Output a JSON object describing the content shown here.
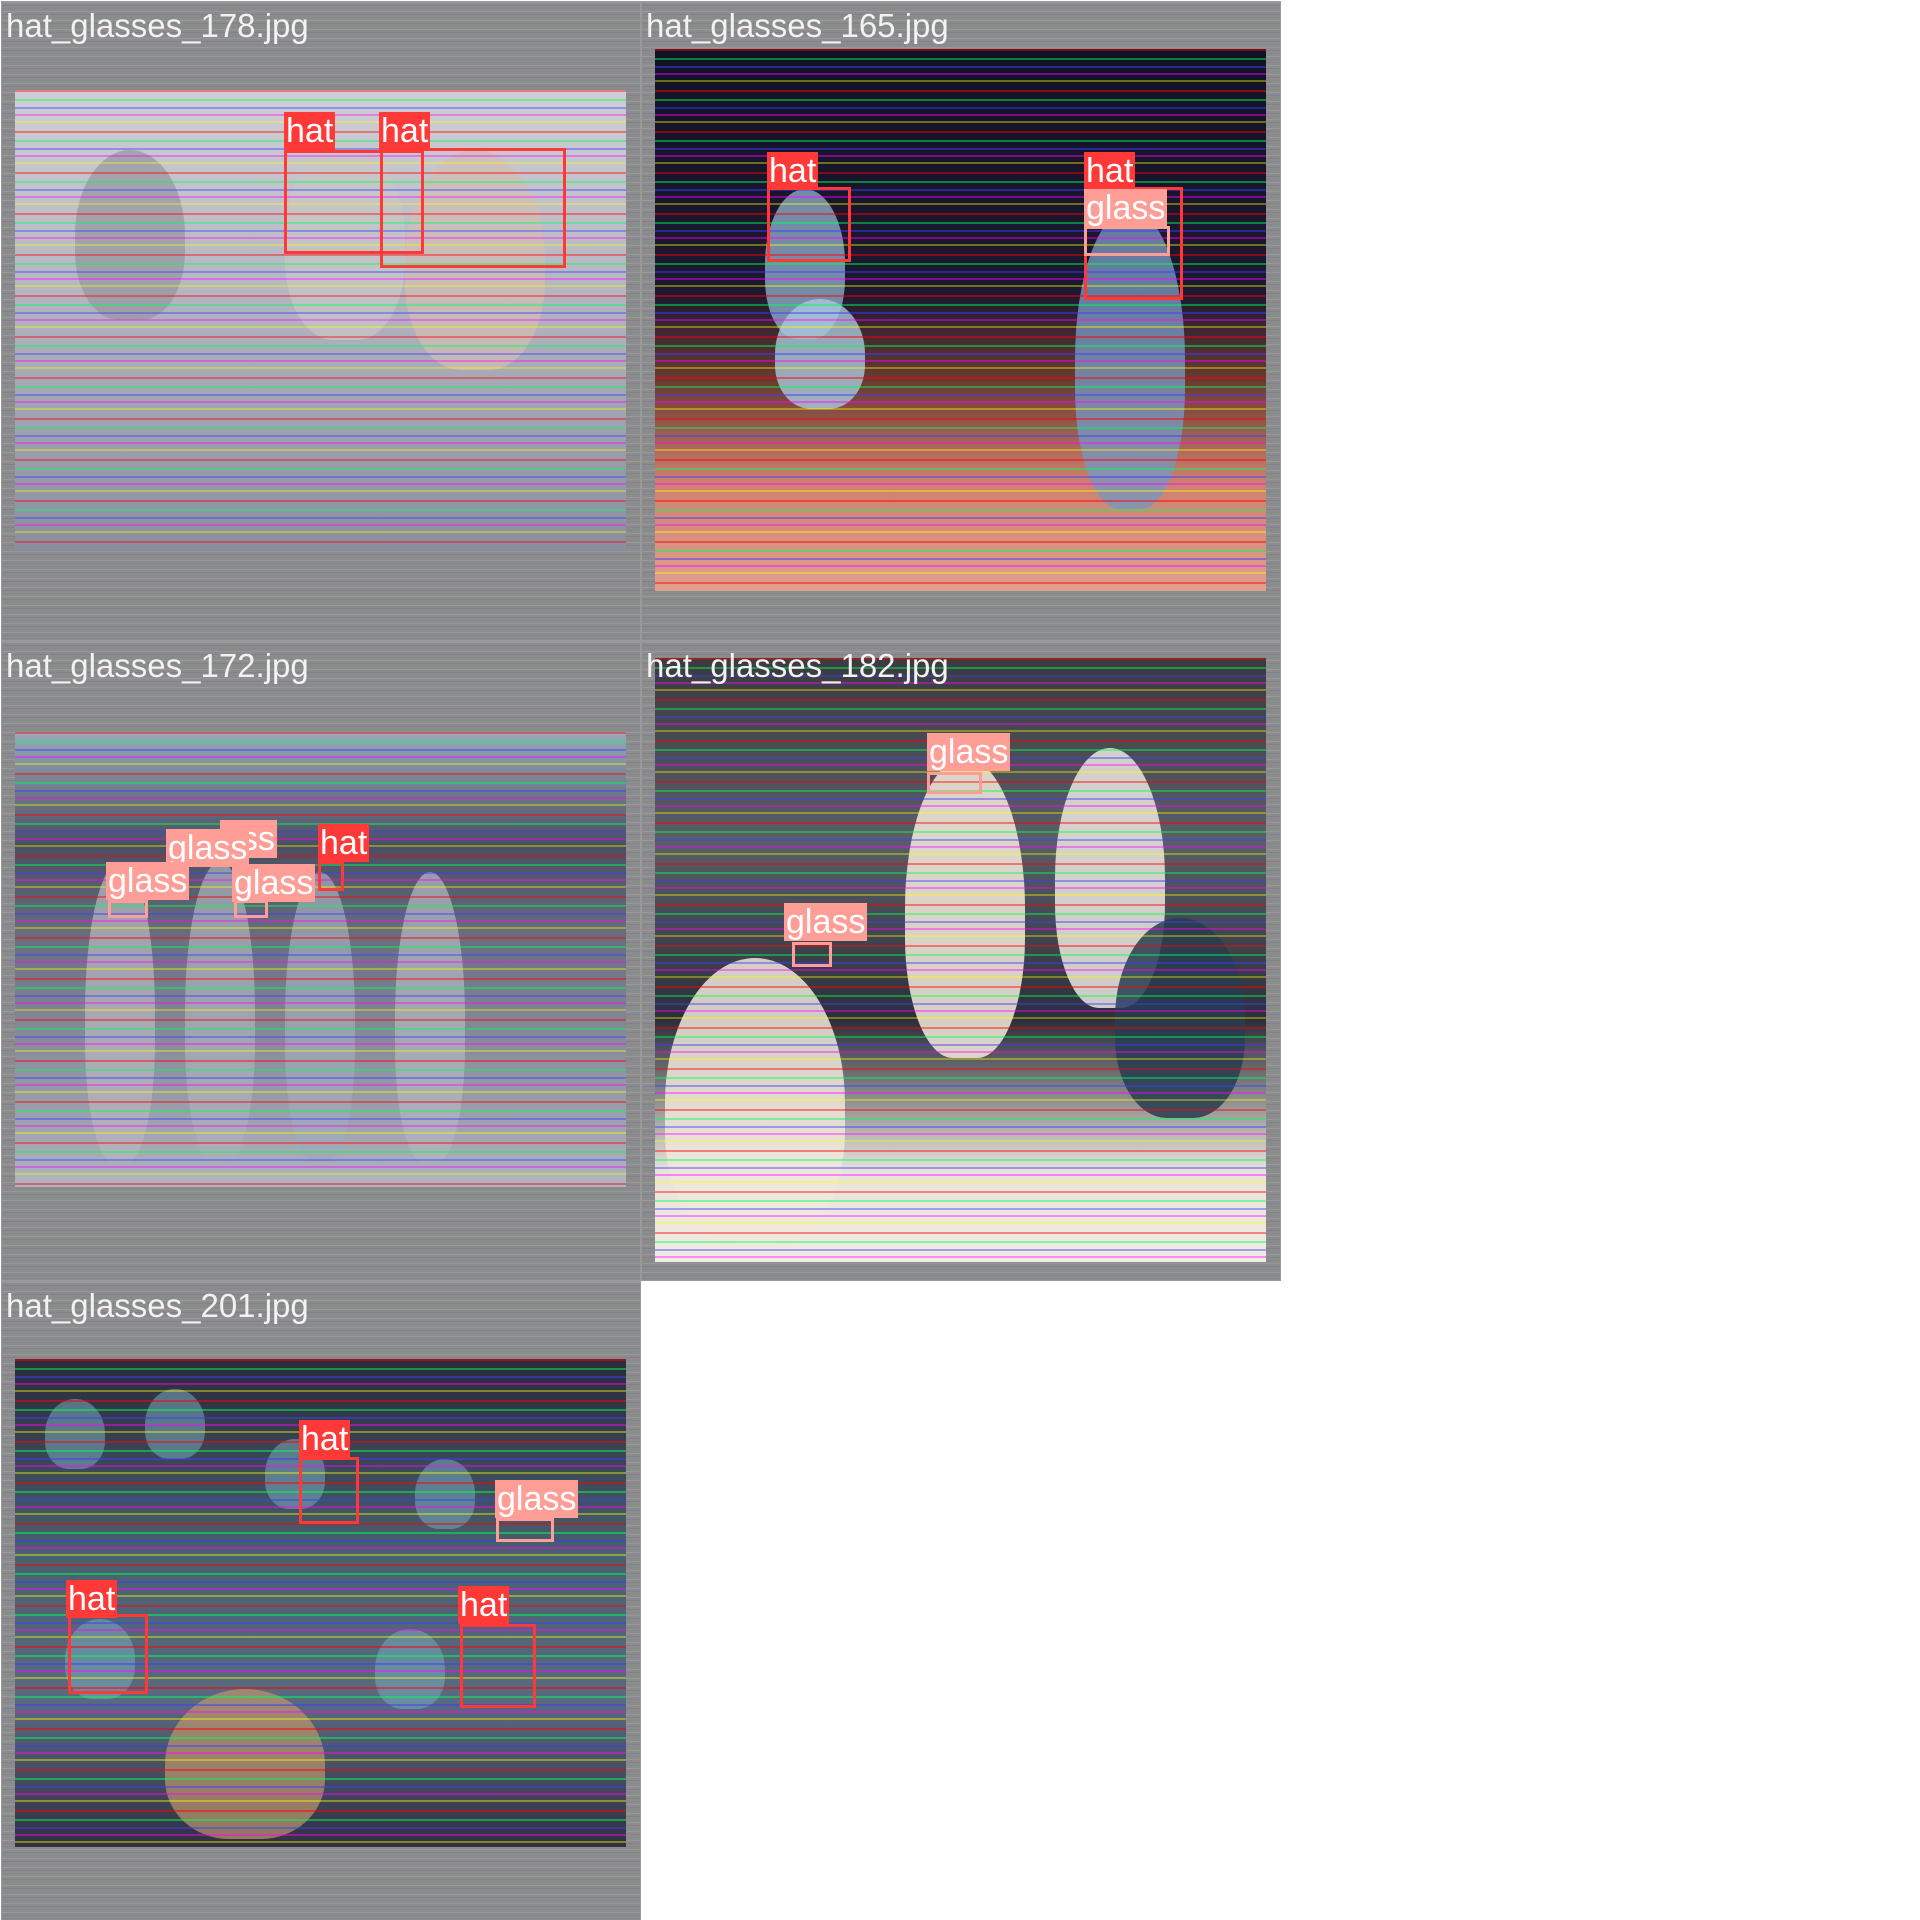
{
  "tiles": [
    {
      "title": "hat_glasses_178.jpg",
      "labels": [
        {
          "text": "hat"
        },
        {
          "text": "hat"
        }
      ]
    },
    {
      "title": "hat_glasses_165.jpg",
      "labels": [
        {
          "text": "hat"
        },
        {
          "text": "hat"
        },
        {
          "text": "glass"
        }
      ]
    },
    {
      "title": "hat_glasses_172.jpg",
      "labels": [
        {
          "text": "ass"
        },
        {
          "text": "glass"
        },
        {
          "text": "hat"
        },
        {
          "text": "glass"
        },
        {
          "text": "glass"
        }
      ]
    },
    {
      "title": "hat_glasses_182.jpg",
      "labels": [
        {
          "text": "glass"
        },
        {
          "text": "glass"
        }
      ]
    },
    {
      "title": "hat_glasses_201.jpg",
      "labels": [
        {
          "text": "hat"
        },
        {
          "text": "glass"
        },
        {
          "text": "hat"
        },
        {
          "text": "hat"
        }
      ]
    }
  ],
  "colors": {
    "hat": "#ff3838",
    "glass": "#ff9d97",
    "tile_bg": "#8c8c8c",
    "page_bg": "#ffffff"
  }
}
